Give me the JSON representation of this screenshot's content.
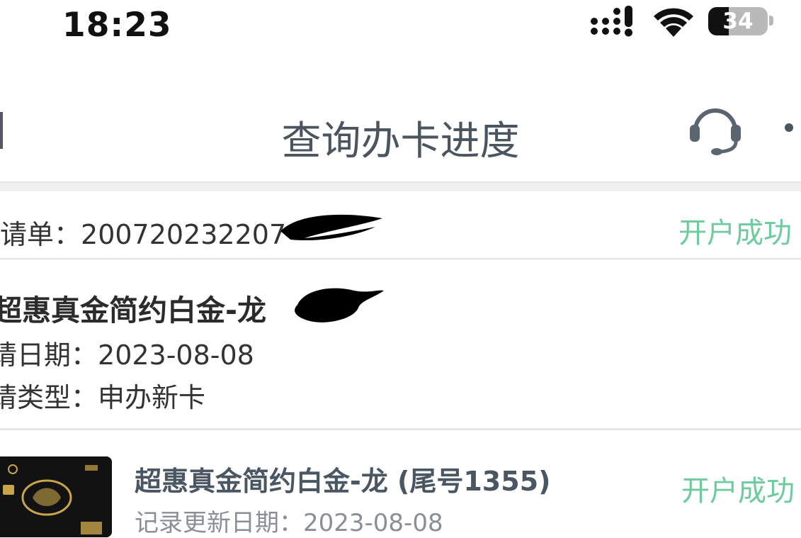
{
  "status_bar": {
    "time": "18:23",
    "battery_percent": "34",
    "battery_level": 0.34
  },
  "nav": {
    "title": "查询办卡进度",
    "icons": [
      "back-icon",
      "headset-icon",
      "more-icon"
    ]
  },
  "application": {
    "order_label": "请单：",
    "order_number": "200720232207",
    "status": "开户成功",
    "card_name": "超惠真金简约白金-龙",
    "apply_date_label": "请日期：",
    "apply_date": "2023-08-08",
    "apply_type_label": "请类型：",
    "apply_type": "申办新卡"
  },
  "card_item": {
    "title": "超惠真金简约白金-龙 (尾号1355)",
    "update_label": "记录更新日期：",
    "update_date": "2023-08-08",
    "status": "开户成功"
  },
  "colors": {
    "status_green": "#6ecb9d",
    "title_gray": "#4a5560",
    "card_black": "#121212"
  }
}
